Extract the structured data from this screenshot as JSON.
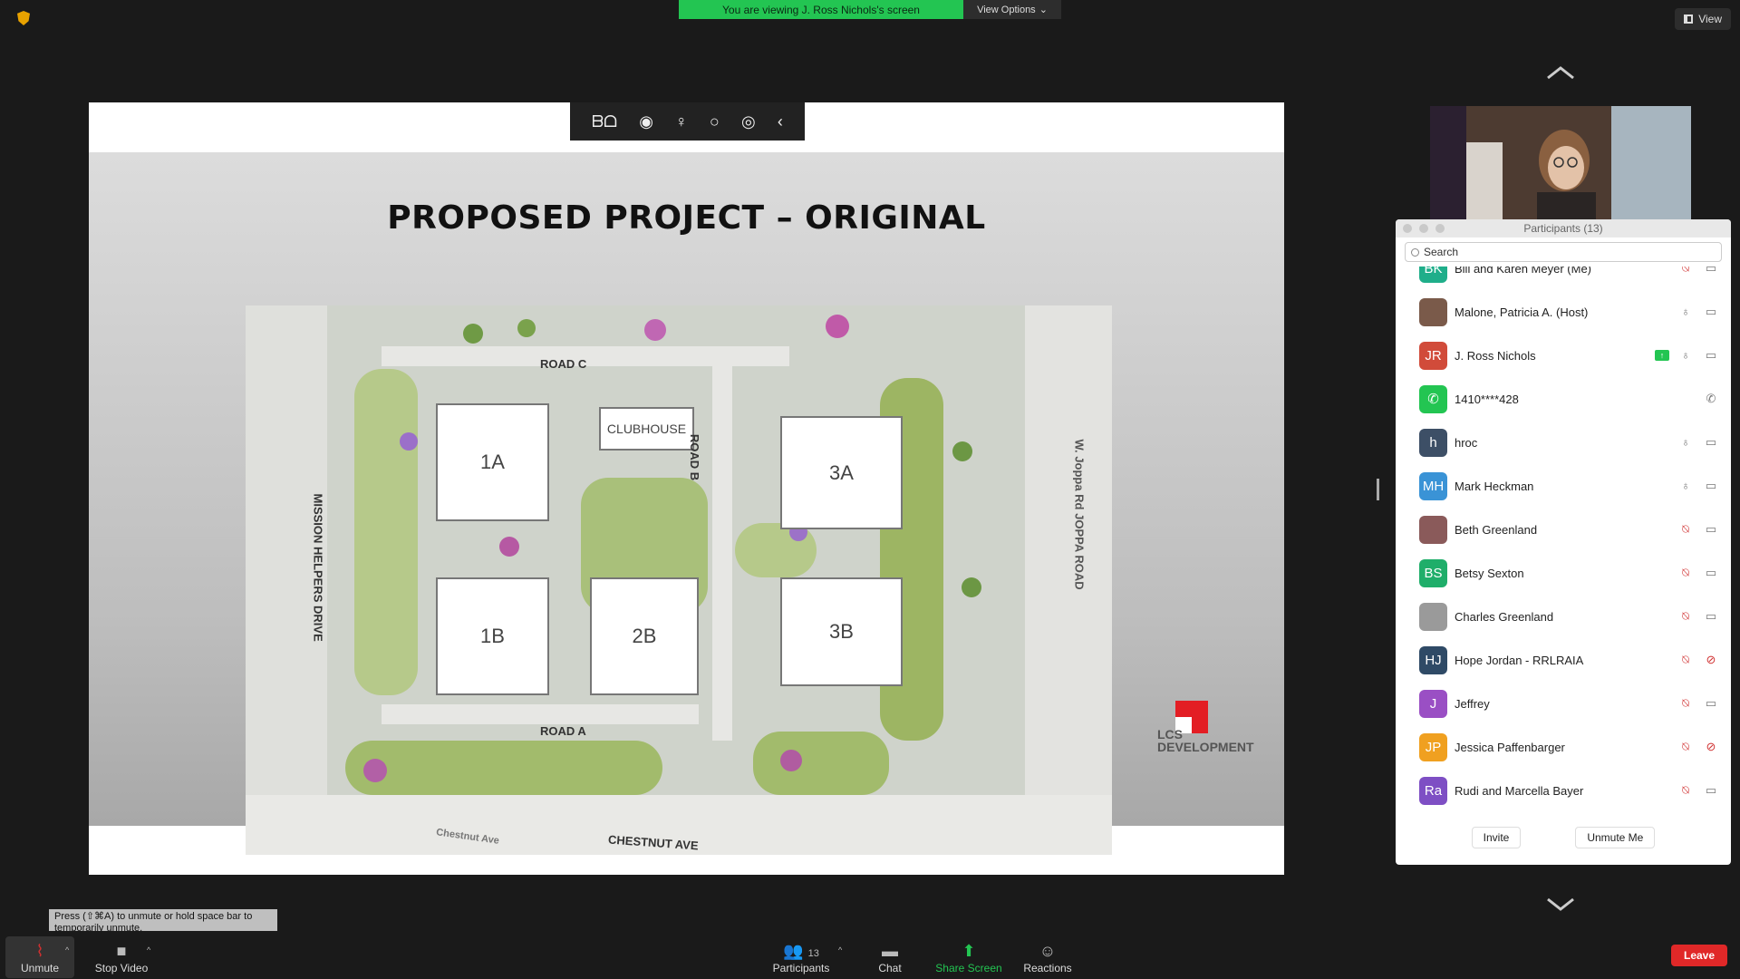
{
  "banner": {
    "viewing": "You are viewing J. Ross Nichols's screen",
    "view_options": "View Options"
  },
  "top_right": {
    "view": "View"
  },
  "slide": {
    "title": "PROPOSED PROJECT – ORIGINAL",
    "buildings": [
      "1A",
      "1B",
      "2B",
      "3A",
      "3B",
      "CLUBHOUSE"
    ],
    "roads": {
      "road_c": "ROAD C",
      "road_b": "ROAD B",
      "road_a": "ROAD A",
      "mission": "MISSION HELPERS DRIVE",
      "joppa": "W. Joppa Rd   JOPPA ROAD",
      "chestnut": "CHESTNUT AVE",
      "chestnut_small": "Chestnut Ave"
    },
    "logo": {
      "line1": "LCS",
      "line2": "DEVELOPMENT"
    }
  },
  "participants": {
    "title": "Participants (13)",
    "search_placeholder": "Search",
    "rows": [
      {
        "initials": "BK",
        "name": "Bill and Karen Meyer (Me)",
        "color": "#1fae8a",
        "mic": "muted",
        "cam": "on"
      },
      {
        "initials": "",
        "name": "Malone, Patricia A. (Host)",
        "color": "#7a5a4a",
        "mic": "on",
        "cam": "on"
      },
      {
        "initials": "JR",
        "name": "J. Ross Nichols",
        "color": "#d14b3a",
        "mic": "on",
        "cam": "on",
        "sharing": true
      },
      {
        "initials": "",
        "name": "1410****428",
        "color": "#23c552",
        "mic": "phone",
        "cam": ""
      },
      {
        "initials": "h",
        "name": "hroc",
        "color": "#3d4f66",
        "mic": "on",
        "cam": "on"
      },
      {
        "initials": "MH",
        "name": "Mark Heckman",
        "color": "#3a93d6",
        "mic": "on",
        "cam": "on"
      },
      {
        "initials": "",
        "name": "Beth Greenland",
        "color": "#8a5a5a",
        "mic": "muted",
        "cam": "on"
      },
      {
        "initials": "BS",
        "name": "Betsy Sexton",
        "color": "#1fae6a",
        "mic": "muted",
        "cam": "on"
      },
      {
        "initials": "",
        "name": "Charles Greenland",
        "color": "#9a9a9a",
        "mic": "muted",
        "cam": "on"
      },
      {
        "initials": "HJ",
        "name": "Hope Jordan - RRLRAIA",
        "color": "#2f4a66",
        "mic": "muted",
        "cam": "off"
      },
      {
        "initials": "J",
        "name": "Jeffrey",
        "color": "#9a4fc4",
        "mic": "muted",
        "cam": "on"
      },
      {
        "initials": "JP",
        "name": "Jessica Paffenbarger",
        "color": "#f0a020",
        "mic": "muted",
        "cam": "off"
      },
      {
        "initials": "Ra",
        "name": "Rudi and Marcella Bayer",
        "color": "#7e4fc4",
        "mic": "muted",
        "cam": "on"
      }
    ],
    "invite": "Invite",
    "unmute_me": "Unmute Me"
  },
  "controls": {
    "unmute": "Unmute",
    "stop_video": "Stop Video",
    "participants": "Participants",
    "participants_count": "13",
    "chat": "Chat",
    "share_screen": "Share Screen",
    "reactions": "Reactions",
    "leave": "Leave",
    "tooltip": "Press  (⇧⌘A) to unmute or hold space bar to temporarily unmute."
  }
}
